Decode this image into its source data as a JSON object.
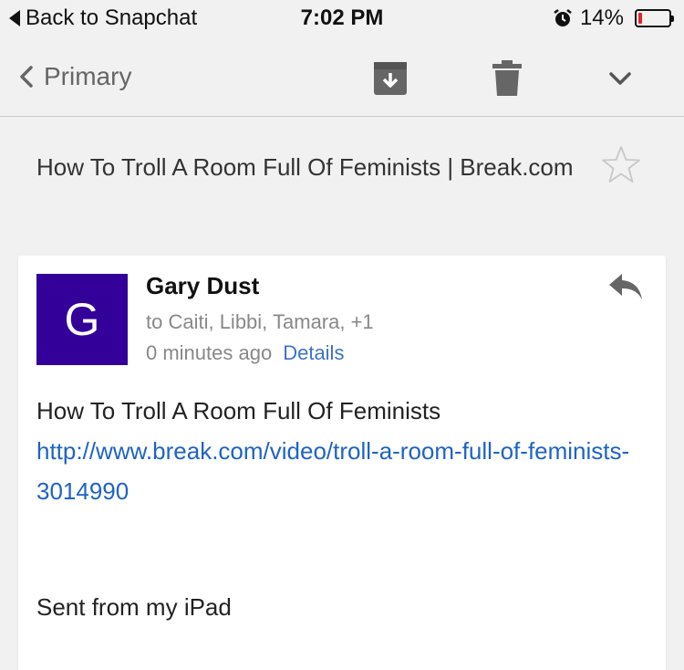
{
  "status_bar": {
    "back_label": "Back to Snapchat",
    "time": "7:02 PM",
    "battery_percent_label": "14%",
    "battery_level": 0.14,
    "battery_color": "#e3242b",
    "alarm_icon": "alarm-clock-icon"
  },
  "toolbar": {
    "back_label": "Primary",
    "archive_icon": "archive-icon",
    "delete_icon": "trash-icon",
    "more_icon": "chevron-down-icon"
  },
  "email": {
    "subject": "How To Troll A Room Full Of Feminists | Break.com",
    "starred": false,
    "avatar_letter": "G",
    "avatar_color": "#330099",
    "sender": "Gary Dust",
    "recipients": "to Caiti, Libbi, Tamara, +1",
    "time_ago": "0 minutes ago",
    "details_label": "Details",
    "body_line": "How To Troll A Room Full Of Feminists",
    "body_link": "http://www.break.com/video/troll-a-room-full-of-feminists-3014990",
    "signature": "Sent from my iPad"
  }
}
